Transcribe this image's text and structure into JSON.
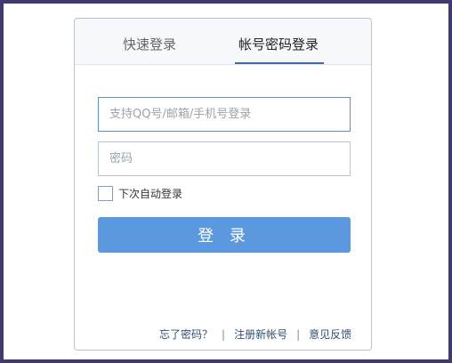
{
  "tabs": {
    "quick_login": "快速登录",
    "account_login": "帐号密码登录"
  },
  "form": {
    "username_placeholder": "支持QQ号/邮箱/手机号登录",
    "username_value": "",
    "password_placeholder": "密码",
    "password_value": "",
    "remember_label": "下次自动登录",
    "remember_checked": false,
    "login_label": "登 录"
  },
  "footer": {
    "forgot_password": "忘了密码？",
    "register": "注册新帐号",
    "feedback": "意见反馈",
    "separator": "|"
  },
  "colors": {
    "frame": "#3f3a6e",
    "button": "#5b98dd",
    "tab_active_underline": "#3f6aa6",
    "link": "#2f4f78"
  }
}
